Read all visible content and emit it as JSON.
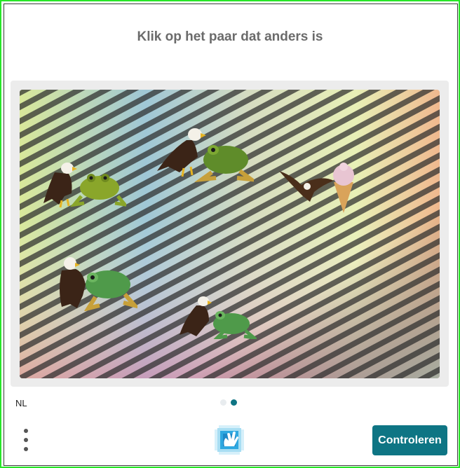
{
  "challenge": {
    "title": "Klik op het paar dat anders is",
    "language": "NL",
    "pager": {
      "pages": 2,
      "active": 2
    },
    "submit_label": "Controleren",
    "pairs": [
      {
        "label": "eagle-frog-pair-1",
        "objects": [
          "eagle",
          "frog"
        ]
      },
      {
        "label": "eagle-frog-pair-2",
        "objects": [
          "eagle",
          "frog"
        ]
      },
      {
        "label": "eagle-icecream-pair",
        "objects": [
          "eagle",
          "ice-cream"
        ]
      },
      {
        "label": "eagle-frog-pair-3",
        "objects": [
          "eagle",
          "frog"
        ]
      },
      {
        "label": "eagle-frog-pair-4",
        "objects": [
          "eagle",
          "frog"
        ]
      }
    ]
  },
  "colors": {
    "accent": "#0e7584",
    "frame": "#27e627",
    "title": "#6b6b6b"
  },
  "icons": {
    "menu": "more-vertical-icon",
    "logo": "hand-logo-icon"
  }
}
